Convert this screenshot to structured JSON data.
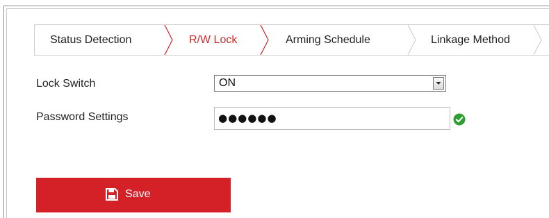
{
  "tabs": [
    {
      "label": "Status Detection",
      "active": false
    },
    {
      "label": "R/W Lock",
      "active": true
    },
    {
      "label": "Arming Schedule",
      "active": false
    },
    {
      "label": "Linkage Method",
      "active": false
    }
  ],
  "form": {
    "lock_switch": {
      "label": "Lock Switch",
      "value": "ON"
    },
    "password": {
      "label": "Password Settings",
      "masked_value": "●●●●●●",
      "valid": true,
      "status_icon": "checkmark-circle-icon"
    }
  },
  "actions": {
    "save_label": "Save",
    "save_icon": "floppy-disk-icon"
  },
  "colors": {
    "accent": "#d42127",
    "active_tab_text": "#cc2b2b",
    "valid_green": "#2e9e2e"
  }
}
